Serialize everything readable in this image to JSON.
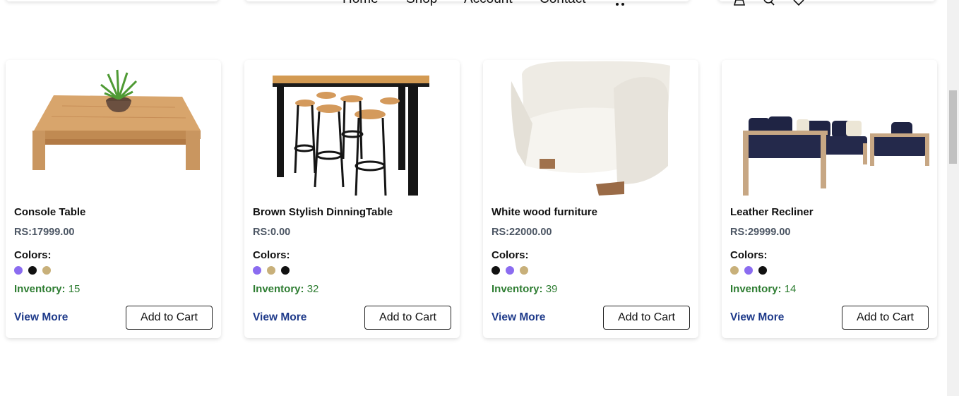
{
  "nav": {
    "links": [
      "Home",
      "Shop",
      "Account",
      "Contact"
    ],
    "icons": [
      "cart-icon",
      "user-icon",
      "search-icon",
      "heart-icon"
    ]
  },
  "products": [
    {
      "title": "Console Table",
      "price": "RS:17999.00",
      "colors_label": "Colors:",
      "colors": [
        "#8b6cf0",
        "#111111",
        "#c8b07a"
      ],
      "inventory_label": "Inventory:",
      "inventory_value": "15",
      "view_more": "View More",
      "add_to_cart": "Add to Cart",
      "image": "coffee-table-with-plant"
    },
    {
      "title": "Brown Stylish DinningTable",
      "price": "RS:0.00",
      "colors_label": "Colors:",
      "colors": [
        "#8b6cf0",
        "#c8b07a",
        "#111111"
      ],
      "inventory_label": "Inventory:",
      "inventory_value": "32",
      "view_more": "View More",
      "add_to_cart": "Add to Cart",
      "image": "bar-table-with-stools"
    },
    {
      "title": "White wood furniture",
      "price": "RS:22000.00",
      "colors_label": "Colors:",
      "colors": [
        "#111111",
        "#8b6cf0",
        "#c8b07a"
      ],
      "inventory_label": "Inventory:",
      "inventory_value": "39",
      "view_more": "View More",
      "add_to_cart": "Add to Cart",
      "image": "white-armchair"
    },
    {
      "title": "Leather Recliner",
      "price": "RS:29999.00",
      "colors_label": "Colors:",
      "colors": [
        "#c8b07a",
        "#8b6cf0",
        "#111111"
      ],
      "inventory_label": "Inventory:",
      "inventory_value": "14",
      "view_more": "View More",
      "add_to_cart": "Add to Cart",
      "image": "navy-sofa-set"
    }
  ]
}
